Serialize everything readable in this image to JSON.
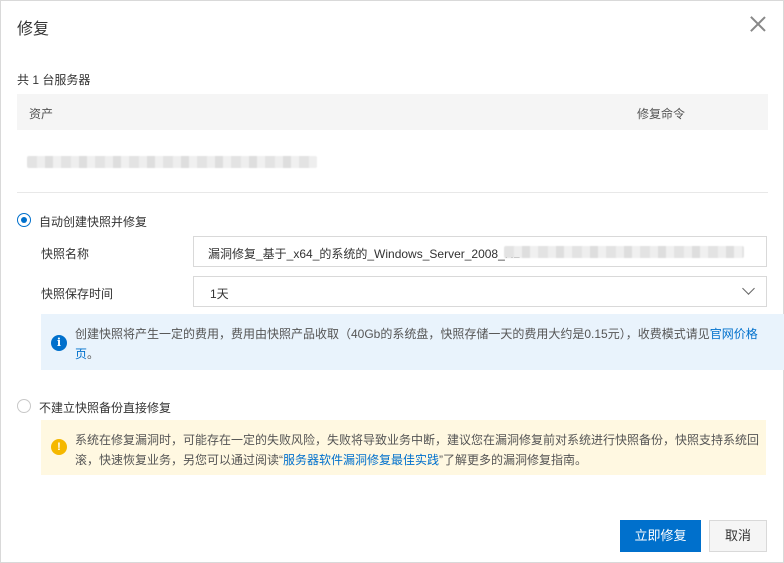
{
  "dialog": {
    "title": "修复"
  },
  "summary": {
    "count_text": "共 1 台服务器"
  },
  "table": {
    "headers": [
      "资产",
      "修复命令"
    ]
  },
  "options": {
    "auto_snapshot": {
      "label": "自动创建快照并修复",
      "selected": true,
      "snapshot_name_label": "快照名称",
      "snapshot_name_value": "漏洞修复_基于_x64_的系统的_Windows_Server_2008_R2",
      "retention_label": "快照保存时间",
      "retention_value": "1天",
      "info_text": "创建快照将产生一定的费用，费用由快照产品收取（40Gb的系统盘，快照存储一天的费用大约是0.15元），收费模式请见",
      "info_link": "官网价格页",
      "info_suffix": "。"
    },
    "no_snapshot": {
      "label": "不建立快照备份直接修复",
      "selected": false,
      "warn_text": "系统在修复漏洞时，可能存在一定的失败风险，失败将导致业务中断，建议您在漏洞修复前对系统进行快照备份，快照支持系统回滚，快速恢复业务，另您可以通过阅读“",
      "warn_link": "服务器软件漏洞修复最佳实践",
      "warn_suffix": "”了解更多的漏洞修复指南。"
    }
  },
  "footer": {
    "confirm_label": "立即修复",
    "cancel_label": "取消"
  },
  "colors": {
    "primary": "#0070cc",
    "info_bg": "#e9f3fc",
    "warn_bg": "#fff8e1",
    "warn_icon": "#f5b800"
  },
  "icons": {
    "close": "close-icon",
    "info": "info-icon",
    "warning": "warning-icon",
    "select": "chevron-down-icon"
  }
}
